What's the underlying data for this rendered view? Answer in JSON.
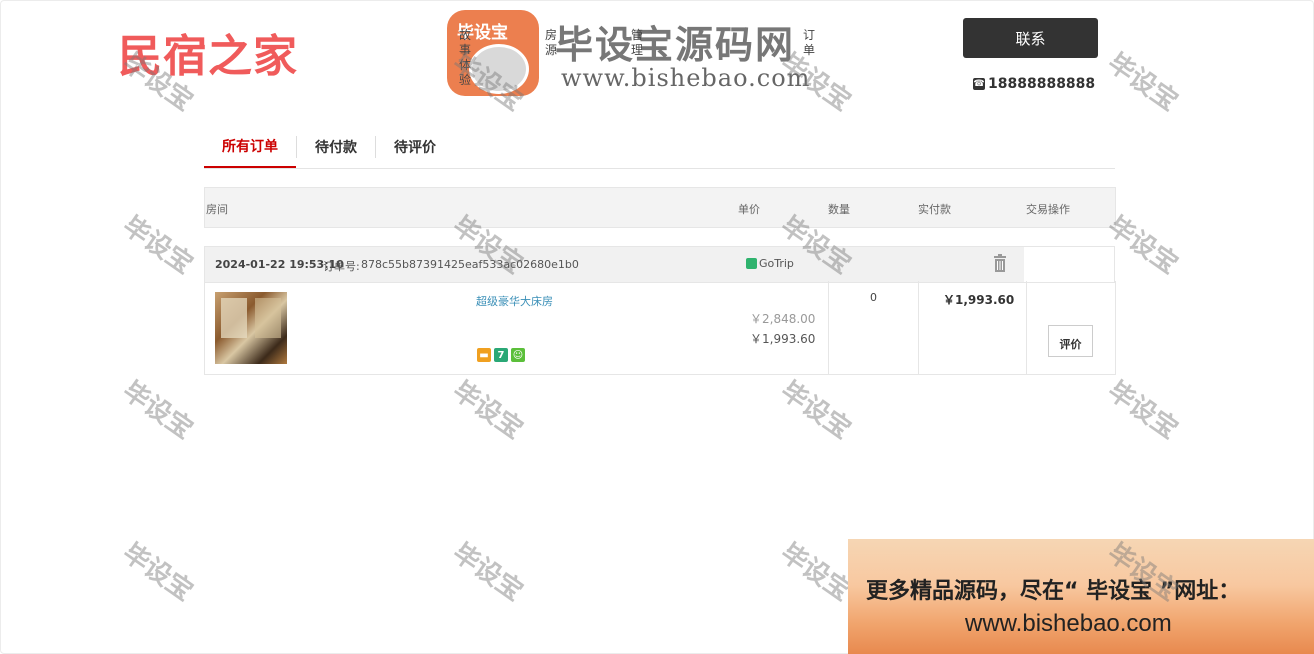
{
  "header": {
    "logo_text": "民宿之家",
    "banner_badge": "毕设宝",
    "banner_title": "毕设宝源码网",
    "banner_url": "www.bishebao.com",
    "side_chars_left": "故事体验",
    "side_chars_mid1": "房源",
    "side_chars_mid2": "管理",
    "side_chars_right": "订单",
    "contact_label": "联系",
    "phone": "18888888888"
  },
  "tabs": [
    {
      "label": "所有订单",
      "active": true
    },
    {
      "label": "待付款",
      "active": false
    },
    {
      "label": "待评价",
      "active": false
    }
  ],
  "table_head": {
    "room": "房间",
    "unit_price": "单价",
    "quantity": "数量",
    "paid": "实付款",
    "action": "交易操作"
  },
  "order": {
    "datetime": "2024-01-22 19:53:10",
    "order_no_label": "订单号:",
    "order_no": "878c55b87391425eaf533ac02680e1b0",
    "platform": "GoTrip",
    "room_name": "超级豪华大床房",
    "original_price": "￥2,848.00",
    "price": "￥1,993.60",
    "quantity": "0",
    "paid": "￥1,993.60",
    "review_label": "评价"
  },
  "watermark": "毕设宝",
  "promo": {
    "line1": "更多精品源码，尽在“ 毕设宝 ”网址：",
    "line2": "www.bishebao.com"
  },
  "colors": {
    "accent": "#cc0000",
    "logo": "#f05b5b",
    "link": "#3a8fb7",
    "dark_button": "#333333"
  }
}
